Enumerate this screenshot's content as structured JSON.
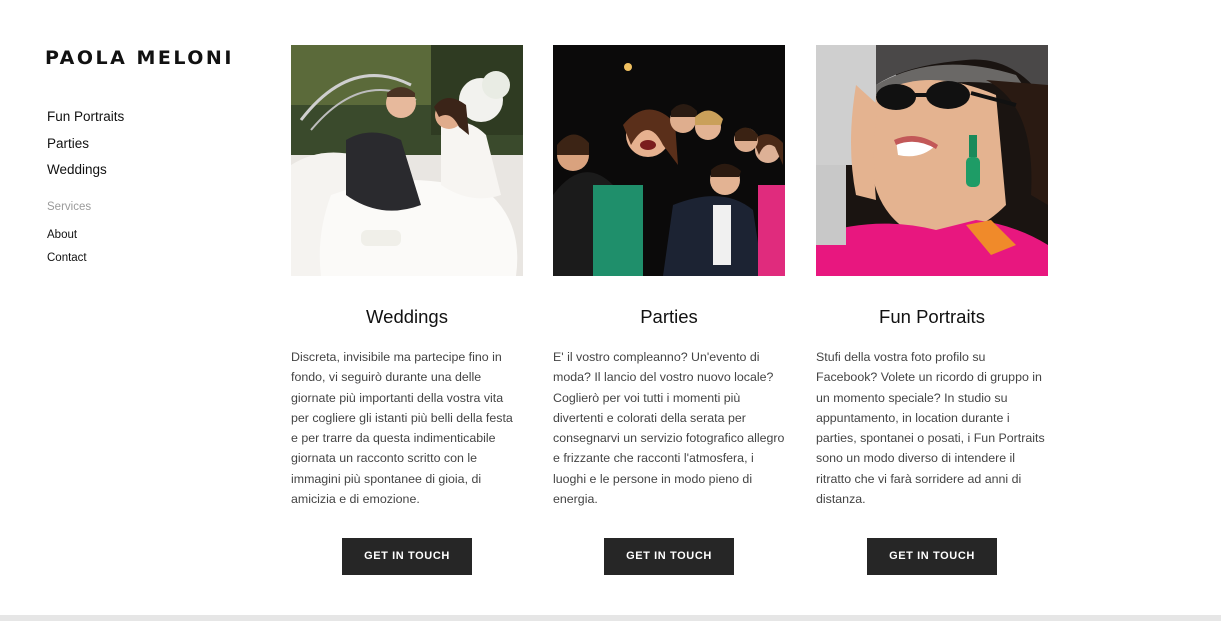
{
  "site": {
    "brand": "PAOLA MELONI"
  },
  "nav": {
    "primary": [
      "Fun Portraits",
      "Parties",
      "Weddings"
    ],
    "section_label": "Services",
    "secondary": [
      "About",
      "Contact"
    ]
  },
  "cards": [
    {
      "title": "Weddings",
      "text": "Discreta, invisibile ma partecipe fino in fondo, vi seguirò durante una delle giornate più importanti della vostra vita per cogliere gli istanti più belli della festa e per trarre da questa indimenticabile giornata un racconto scritto con le immagini più spontanee di gioia, di amicizia e di emozione.",
      "button": "GET IN TOUCH",
      "photo_icon": "wedding-couple-photo"
    },
    {
      "title": "Parties",
      "text": "E' il vostro compleanno? Un'evento di moda? Il lancio del vostro nuovo locale? Coglierò per voi tutti i momenti più divertenti e colorati della serata per consegnarvi un servizio fotografico allegro e frizzante che racconti l'atmosfera, i luoghi e le persone in modo pieno di energia.",
      "button": "GET IN TOUCH",
      "photo_icon": "party-group-photo"
    },
    {
      "title": "Fun Portraits",
      "text": "Stufi della vostra foto profilo su Facebook? Volete un ricordo di gruppo in un momento speciale? In studio su appuntamento, in location durante i parties, spontanei o posati, i Fun Portraits sono un modo diverso di intendere il ritratto che vi farà sorridere ad anni di distanza.",
      "button": "GET IN TOUCH",
      "photo_icon": "portrait-sunglasses-photo"
    }
  ],
  "colors": {
    "button_bg": "#262626",
    "accent_pink": "#e8177f"
  }
}
